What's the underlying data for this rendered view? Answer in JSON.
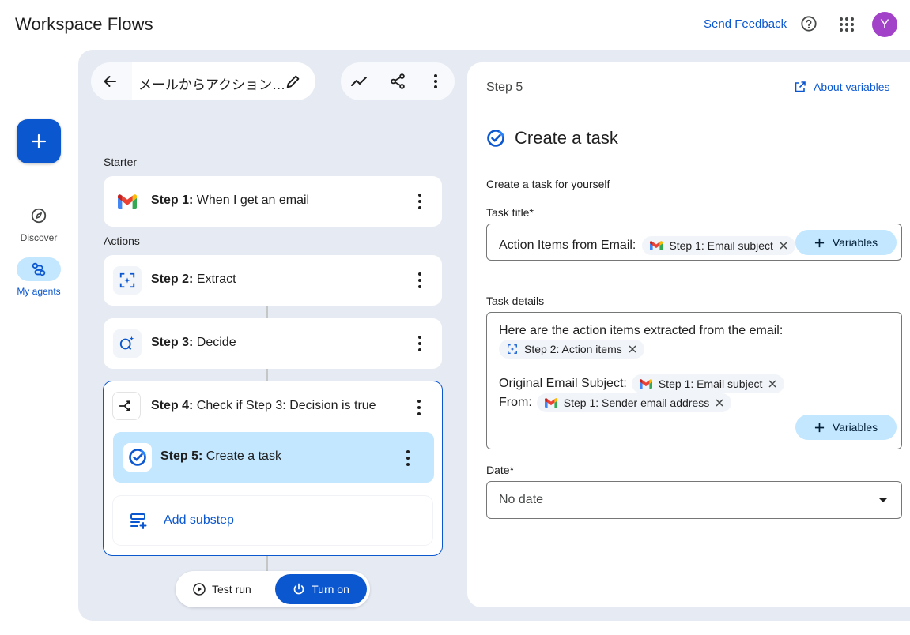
{
  "app": {
    "title": "Workspace Flows",
    "feedback_label": "Send Feedback",
    "avatar_initial": "Y"
  },
  "colors": {
    "accent": "#0b57d0",
    "selected": "#c2e7ff",
    "avatar": "#a142c8",
    "canvas": "#e6eaf3"
  },
  "nav": {
    "create_icon": "plus-icon",
    "discover_label": "Discover",
    "agents_label": "My agents"
  },
  "flow": {
    "name": "メールからアクション…"
  },
  "steps": {
    "starter_label": "Starter",
    "actions_label": "Actions",
    "step1": {
      "prefix": "Step 1:",
      "label": "When I get an email"
    },
    "step2": {
      "prefix": "Step 2:",
      "label": "Extract"
    },
    "step3": {
      "prefix": "Step 3:",
      "label": "Decide"
    },
    "step4": {
      "prefix": "Step 4:",
      "label": "Check if Step 3: Decision is true"
    },
    "step5": {
      "prefix": "Step 5:",
      "label": "Create a task"
    },
    "add_substep_label": "Add substep"
  },
  "run": {
    "test_label": "Test run",
    "turn_on_label": "Turn on"
  },
  "panel": {
    "step_label": "Step 5",
    "about_label": "About variables",
    "action_title": "Create a task",
    "description": "Create a task for yourself",
    "task_title": {
      "label": "Task title*",
      "text": "Action Items from Email:",
      "chip": "Step 1: Email subject",
      "variables_label": "Variables"
    },
    "task_details": {
      "label": "Task details",
      "line1": "Here are the action items extracted from the email:",
      "chip_action_items": "Step 2: Action items",
      "subject_label": "Original Email Subject:",
      "chip_subject": "Step 1: Email subject",
      "from_label": "From:",
      "chip_sender": "Step 1: Sender email address",
      "variables_label": "Variables"
    },
    "date": {
      "label": "Date*",
      "value": "No date"
    }
  }
}
